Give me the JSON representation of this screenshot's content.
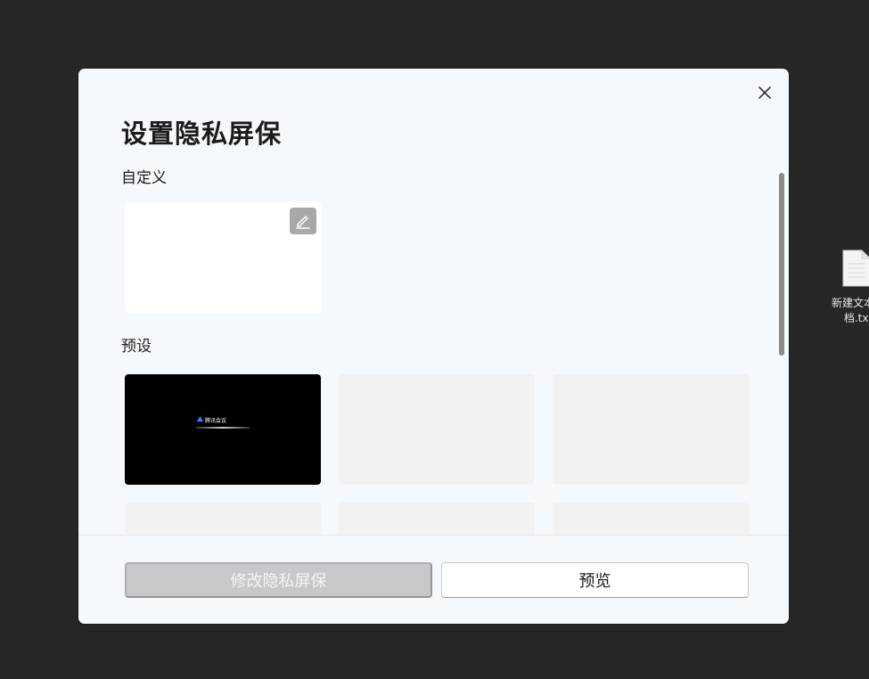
{
  "desktop": {
    "file_icon": {
      "icon": "text-file-icon",
      "name": "新建文本文档.txt"
    }
  },
  "dialog": {
    "title": "设置隐私屏保",
    "close_icon": "close-icon",
    "custom_section": {
      "label": "自定义",
      "edit_icon": "pencil-icon"
    },
    "preset_section": {
      "label": "预设",
      "tiles": [
        {
          "style": "dark",
          "logo_text": "腾讯会议"
        },
        {
          "style": "placeholder"
        },
        {
          "style": "placeholder"
        },
        {
          "style": "placeholder"
        },
        {
          "style": "placeholder"
        },
        {
          "style": "placeholder"
        }
      ]
    },
    "buttons": {
      "apply_label": "修改隐私屏保",
      "apply_disabled": true,
      "preview_label": "预览"
    }
  },
  "colors": {
    "desktop_bg": "#262626",
    "dialog_bg": "#f6f9fc",
    "disabled_button": "#c6c8c9",
    "placeholder_tile": "#f2f2f2"
  }
}
